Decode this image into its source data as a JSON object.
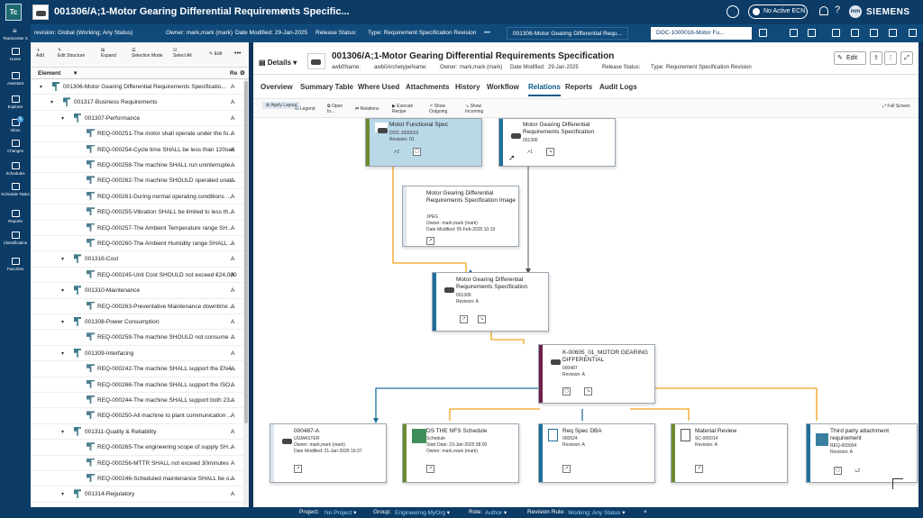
{
  "app": {
    "logo_text": "Tc",
    "title": "001306/A;1-Motor Gearing Differential Requirements Specific...",
    "ecn_label": "No Active ECN",
    "user_initials": "mm",
    "brand": "SIEMENS"
  },
  "context": {
    "revision": "revision:  Global (Working; Any Status)",
    "owner": "Owner:  mark,mark (mark)",
    "date": "Date Modified:  29-Jan-2025",
    "release": "Release Status:",
    "type": "Type:  Requirement Specification Revision",
    "tab1": "001306-Motor Gearing Differential Requ...",
    "tab2": "DOC-1000016-Motor Fu..."
  },
  "nav": {
    "product": "Teamcenter X",
    "items": [
      "Home",
      "Assistant",
      "Explorer",
      "Inbox",
      "Changes",
      "Schedules",
      "Schedule Tasks",
      "Reports",
      "Classification",
      "Favorites"
    ],
    "inbox_badge": "1"
  },
  "left_toolbar": {
    "add": "Add",
    "edit_structure": "Edit Structure",
    "expand": "Expand",
    "selection_mode": "Selection Mode",
    "select_all": "Select All",
    "edit": "Edit",
    "more": "•••"
  },
  "left_header": {
    "element": "Element",
    "rev": "Re"
  },
  "tree": [
    {
      "label": "001306-Motor Gearing Differential Requirements Specificatio...",
      "rev": "A",
      "level": 0,
      "type": "spec"
    },
    {
      "label": "001317-Business Requirements",
      "rev": "A",
      "level": 1,
      "type": "para"
    },
    {
      "label": "001307-Performance",
      "rev": "A",
      "level": 2,
      "type": "para"
    },
    {
      "label": "REQ-000251-The motor shall operate under the fo...",
      "rev": "A",
      "level": 3,
      "type": "req"
    },
    {
      "label": "REQ-000254-Cycle time SHALL be less than 120sec",
      "rev": "A",
      "level": 3,
      "type": "req"
    },
    {
      "label": "REQ-000258-The machine SHALL run uninterrupte...",
      "rev": "A",
      "level": 3,
      "type": "req"
    },
    {
      "label": "REQ-000262-The machine SHOULD operated unat...",
      "rev": "A",
      "level": 3,
      "type": "req"
    },
    {
      "label": "REQ-000261-During normal operating conditions ...",
      "rev": "A",
      "level": 3,
      "type": "req"
    },
    {
      "label": "REQ-000255-Vibration SHALL be limited to less th...",
      "rev": "A",
      "level": 3,
      "type": "req"
    },
    {
      "label": "REQ-000257-The Ambient Temperature range SH...",
      "rev": "A",
      "level": 3,
      "type": "req"
    },
    {
      "label": "REQ-000260-The Ambient Humidity range SHALL ...",
      "rev": "A",
      "level": 3,
      "type": "req"
    },
    {
      "label": "001316-Cost",
      "rev": "A",
      "level": 2,
      "type": "para"
    },
    {
      "label": "REQ-000245-Unit Cost SHOULD not exceed €24,000",
      "rev": "A",
      "level": 3,
      "type": "req"
    },
    {
      "label": "001310-Maintenance",
      "rev": "A",
      "level": 2,
      "type": "para"
    },
    {
      "label": "REQ-000263-Preventative Maintenance downtime ...",
      "rev": "A",
      "level": 3,
      "type": "req"
    },
    {
      "label": "001308-Power Consumption",
      "rev": "A",
      "level": 2,
      "type": "para"
    },
    {
      "label": "REQ-000259-The machine SHOULD not consume ...",
      "rev": "A",
      "level": 3,
      "type": "req"
    },
    {
      "label": "001309-Interfacing",
      "rev": "A",
      "level": 2,
      "type": "para"
    },
    {
      "label": "REQ-000242-The machine SHALL support the EN4...",
      "rev": "A",
      "level": 3,
      "type": "req"
    },
    {
      "label": "REQ-000266-The machine SHALL support the ISO...",
      "rev": "A",
      "level": 3,
      "type": "req"
    },
    {
      "label": "REQ-000244-The machine SHALL support both 23...",
      "rev": "A",
      "level": 3,
      "type": "req"
    },
    {
      "label": "REQ-000250-All machine to plant communication ...",
      "rev": "A",
      "level": 3,
      "type": "req"
    },
    {
      "label": "001311-Quality & Reliability",
      "rev": "A",
      "level": 2,
      "type": "para"
    },
    {
      "label": "REQ-000265-The engineering scope of supply SH...",
      "rev": "A",
      "level": 3,
      "type": "req"
    },
    {
      "label": "REQ-000256-MTTR SHALL not exceed 30minutes",
      "rev": "A",
      "level": 3,
      "type": "req"
    },
    {
      "label": "REQ-000246-Scheduled maintenance SHALL be o...",
      "rev": "A",
      "level": 3,
      "type": "req"
    },
    {
      "label": "001314-Regulatory",
      "rev": "A",
      "level": 2,
      "type": "para"
    }
  ],
  "details": {
    "toggle": "Details",
    "title": "001306/A;1-Motor Gearing Differential Requirements Specification",
    "props": {
      "name": "awb0Name:",
      "archetype": "awb0ArchetypeName:",
      "owner_label": "Owner:",
      "owner": "mark,mark (mark)",
      "date_label": "Date Modified:",
      "date": "29-Jan-2025",
      "release": "Release Status:",
      "type_label": "Type:",
      "type": "Requirement Specification Revision"
    },
    "edit": "Edit"
  },
  "tabs": [
    "Overview",
    "Summary Table",
    "Where Used",
    "Attachments",
    "History",
    "Workflow",
    "Relations",
    "Reports",
    "Audit Logs"
  ],
  "relations_toolbar": {
    "apply_layout": "Apply Layout",
    "legend": "Legend",
    "open_in": "Open In...",
    "relations": "Relations",
    "execute_recipe": "Execute Recipe",
    "show_outgoing": "Show Outgoing",
    "show_incoming": "Show Incoming",
    "full_screen": "Full Screen"
  },
  "nodes": {
    "motor_spec": {
      "title": "Motor Functional Spec",
      "id": "DOC-1000016",
      "rev": "Revision: 01",
      "count": "2"
    },
    "mgd_top": {
      "title": "Motor Gearing Differential Requirements Specification",
      "id": "001306",
      "count": "1"
    },
    "mgd_image": {
      "title": "Motor Gearing Differential Requirements Specification Image",
      "type": "JPEG",
      "owner": "Owner: mark,mark (mark)",
      "date": "Date Modified: 05-Feb-2025 10:19"
    },
    "mgd_main": {
      "title": "Motor Gearing Differential Requirements Specification",
      "id": "001306",
      "rev": "Revision: A"
    },
    "k_node": {
      "title": "K-00605_01_MOTOR GEARING DIFFERENTIAL",
      "id": "000487",
      "rev": "Revision: A"
    },
    "part_487": {
      "title": "000487-A",
      "type": "UGMASTER",
      "owner": "Owner: mark,mark (mark)",
      "date": "Date Modified: 21-Jan-2025 16:37"
    },
    "schedule": {
      "title": "DS THE NFS Schedule",
      "type": "Schedule",
      "start": "Start Date: 23-Jan-2025 08:00",
      "owner": "Owner: mark,mark (mark)"
    },
    "reqspec": {
      "title": "Req Spec DBA",
      "id": "000524",
      "rev": "Revision: A"
    },
    "material": {
      "title": "Material Review",
      "id": "SC-000014",
      "rev": "Revision: A"
    },
    "third_party": {
      "title": "Third party attachment requirement",
      "id": "REQ-000004",
      "rev": "Revision: A",
      "count": "2"
    }
  },
  "status": {
    "project_label": "Project:",
    "project": "No Project",
    "group_label": "Group:",
    "group": "Engineering.MyOrg",
    "role_label": "Role:",
    "role": "Author",
    "rule_label": "Revision Rule:",
    "rule": "Working; Any Status"
  },
  "colors": {
    "accent": "#0c3b66",
    "orange_wire": "#f2a31b",
    "teal_bar": "#1f6f9a",
    "olive_bar": "#6f8a2e",
    "maroon_bar": "#6d1f47"
  }
}
